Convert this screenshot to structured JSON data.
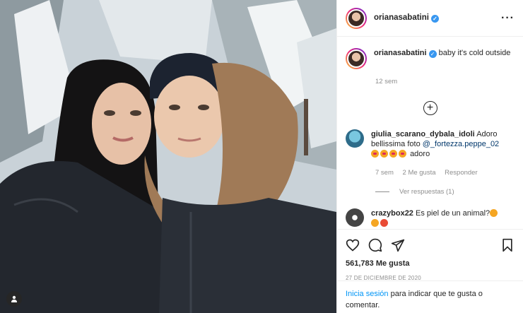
{
  "post": {
    "author": "orianasabatini",
    "caption": "baby it's cold outside",
    "time_ago": "12 sem"
  },
  "icons": {
    "more": "more-options-icon",
    "verified": "verified-badge-icon",
    "add": "plus-circle-icon",
    "like": "heart-icon",
    "comment": "comment-icon",
    "share": "paper-plane-icon",
    "save": "bookmark-icon",
    "user_tag": "user-tag-icon"
  },
  "comments": [
    {
      "username": "giulia_scarano_dybala_idoli",
      "text_before": "Adoro bellissima foto",
      "mention": "@_fortezza.peppe_02",
      "text_after": "adoro",
      "time": "7 sem",
      "likes": "2 Me gusta",
      "reply": "Responder",
      "view_replies": "Ver respuestas (1)"
    },
    {
      "username": "crazybox22",
      "text": "Es piel de un animal?"
    }
  ],
  "likes_count": "561,783 Me gusta",
  "date": "27 de diciembre de 2020",
  "login_prompt": {
    "link": "Inicia sesión",
    "text": "para indicar que te gusta o comentar."
  },
  "colors": {
    "verified": "#3897f0",
    "link": "#00376b",
    "login_link": "#0095f6"
  }
}
